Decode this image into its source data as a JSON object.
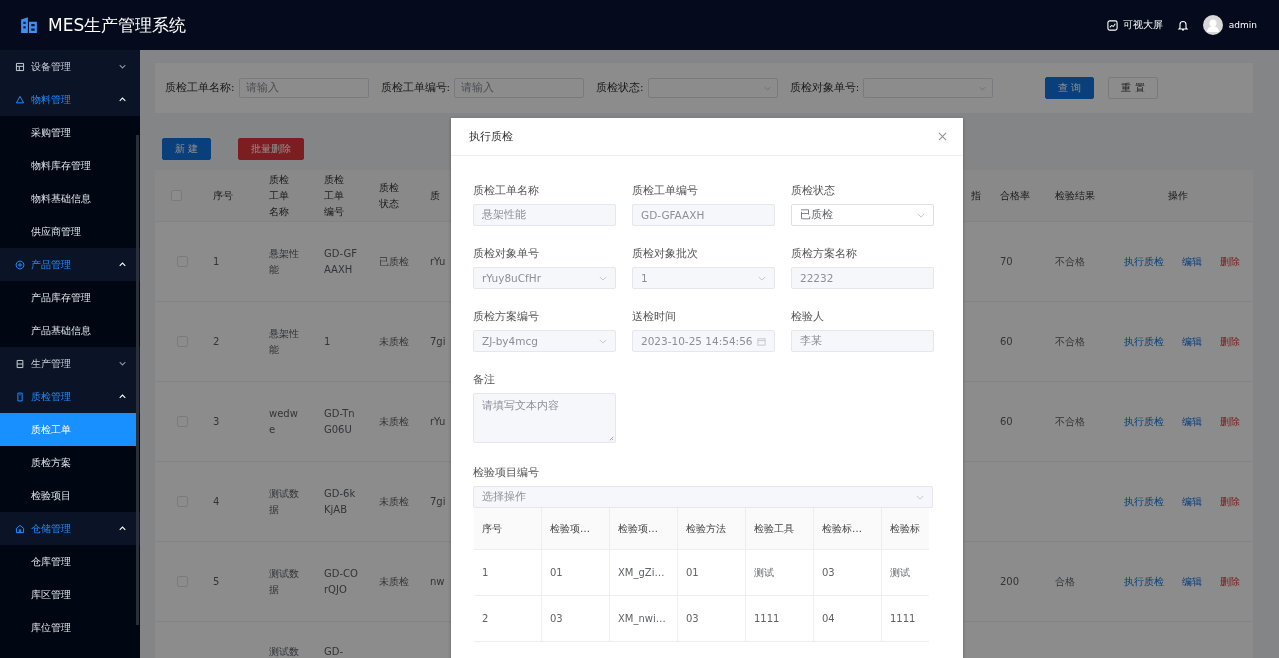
{
  "header": {
    "title": "MES生产管理系统",
    "screen_link": "可视大屏",
    "user": "admin"
  },
  "sidebar": {
    "groups": [
      {
        "label": "设备管理",
        "expanded": false
      },
      {
        "label": "物料管理",
        "expanded": true,
        "children": [
          {
            "label": "采购管理",
            "selected": false
          },
          {
            "label": "物料库存管理",
            "selected": false
          },
          {
            "label": "物料基础信息",
            "selected": false
          },
          {
            "label": "供应商管理",
            "selected": false
          }
        ]
      },
      {
        "label": "产品管理",
        "expanded": true,
        "children": [
          {
            "label": "产品库存管理",
            "selected": false
          },
          {
            "label": "产品基础信息",
            "selected": false
          }
        ]
      },
      {
        "label": "生产管理",
        "expanded": false
      },
      {
        "label": "质检管理",
        "expanded": true,
        "children": [
          {
            "label": "质检工单",
            "selected": true
          },
          {
            "label": "质检方案",
            "selected": false
          },
          {
            "label": "检验项目",
            "selected": false
          }
        ]
      },
      {
        "label": "仓储管理",
        "expanded": true,
        "children": [
          {
            "label": "仓库管理",
            "selected": false
          },
          {
            "label": "库区管理",
            "selected": false
          },
          {
            "label": "库位管理",
            "selected": false
          }
        ]
      }
    ]
  },
  "search": {
    "fields": [
      {
        "label": "质检工单名称:",
        "kind": "input",
        "placeholder": "请输入"
      },
      {
        "label": "质检工单编号:",
        "kind": "input",
        "placeholder": "请输入"
      },
      {
        "label": "质检状态:",
        "kind": "select"
      },
      {
        "label": "质检对象单号:",
        "kind": "select"
      }
    ],
    "buttons": [
      {
        "label": "查 询",
        "kind": "primary"
      },
      {
        "label": "重 置",
        "kind": "default"
      }
    ]
  },
  "toolbar": [
    {
      "label": "新 建",
      "kind": "primary"
    },
    {
      "label": "批量删除",
      "kind": "danger"
    }
  ],
  "table": {
    "select_all_checked": false,
    "columns_left": [
      "序号",
      "质检工单名称",
      "质检工单编号",
      "质检状态",
      "质"
    ],
    "columns_right": [
      "指",
      "合格率",
      "检验结果",
      "操作"
    ],
    "rows": [
      {
        "checked": false,
        "index": "1",
        "name": "悬架性能",
        "code": "GD-GFAAXH",
        "status": "已质检",
        "column_5": "rYu",
        "rate": "70",
        "result": "不合格",
        "actions": [
          {
            "label": "执行质检",
            "kind": "link"
          },
          {
            "label": "编辑",
            "kind": "link"
          },
          {
            "label": "删除",
            "kind": "danger"
          }
        ]
      },
      {
        "checked": false,
        "index": "2",
        "name": "悬架性能",
        "code": "1",
        "status": "未质检",
        "column_5": "7gi",
        "rate": "60",
        "result": "不合格",
        "actions": [
          {
            "label": "执行质检",
            "kind": "link"
          },
          {
            "label": "编辑",
            "kind": "link"
          },
          {
            "label": "删除",
            "kind": "danger"
          }
        ]
      },
      {
        "checked": false,
        "index": "3",
        "name": "wedwe",
        "code": "GD-TnG06U",
        "status": "未质检",
        "column_5": "rYu",
        "rate": "60",
        "result": "不合格",
        "actions": [
          {
            "label": "执行质检",
            "kind": "link"
          },
          {
            "label": "编辑",
            "kind": "link"
          },
          {
            "label": "删除",
            "kind": "danger"
          }
        ]
      },
      {
        "checked": false,
        "index": "4",
        "name": "测试数据",
        "code": "GD-6kKjAB",
        "status": "未质检",
        "column_5": "7gi",
        "actions": [
          {
            "label": "执行质检",
            "kind": "link"
          },
          {
            "label": "编辑",
            "kind": "link"
          },
          {
            "label": "删除",
            "kind": "danger"
          }
        ]
      },
      {
        "checked": false,
        "index": "5",
        "name": "测试数据",
        "code": "GD-COrQJO",
        "status": "未质检",
        "column_5": "nw",
        "rate": "200",
        "result": "合格",
        "actions": [
          {
            "label": "执行质检",
            "kind": "link"
          },
          {
            "label": "编辑",
            "kind": "link"
          },
          {
            "label": "删除",
            "kind": "danger"
          }
        ]
      },
      {
        "partial": true,
        "name": "测试数",
        "code": "GD-"
      }
    ]
  },
  "dialog": {
    "title": "执行质检",
    "fields": [
      {
        "label": "质检工单名称",
        "kind": "input",
        "disabled": true,
        "value": "悬架性能"
      },
      {
        "label": "质检工单编号",
        "kind": "input",
        "disabled": true,
        "value": "GD-GFAAXH"
      },
      {
        "label": "质检状态",
        "kind": "select",
        "disabled": false,
        "value": "已质检"
      },
      {
        "label": "质检对象单号",
        "kind": "select",
        "disabled": true,
        "value": "rYuy8uCfHr"
      },
      {
        "label": "质检对象批次",
        "kind": "select",
        "disabled": true,
        "value": "1"
      },
      {
        "label": "质检方案名称",
        "kind": "input",
        "disabled": true,
        "value": "22232"
      },
      {
        "label": "质检方案编号",
        "kind": "select",
        "disabled": true,
        "value": "ZJ-by4mcg"
      },
      {
        "label": "送检时间",
        "kind": "date",
        "disabled": true,
        "value": "2023-10-25 14:54:56"
      },
      {
        "label": "检验人",
        "kind": "input",
        "disabled": true,
        "value": "李某"
      },
      {
        "label": "备注",
        "kind": "textarea",
        "disabled": true,
        "placeholder": "请填写文本内容"
      }
    ],
    "items_field": {
      "label": "检验项目编号",
      "kind": "select",
      "disabled": true,
      "placeholder": "选择操作"
    },
    "items_table": {
      "columns": [
        "序号",
        "检验项…",
        "检验项…",
        "检验方法",
        "检验工具",
        "检验标…",
        "检验标"
      ],
      "rows": [
        [
          "1",
          "01",
          "XM_gZi…",
          "01",
          "测试",
          "03",
          "测试"
        ],
        [
          "2",
          "03",
          "XM_nwi…",
          "03",
          "1111",
          "04",
          "1111"
        ]
      ]
    }
  }
}
